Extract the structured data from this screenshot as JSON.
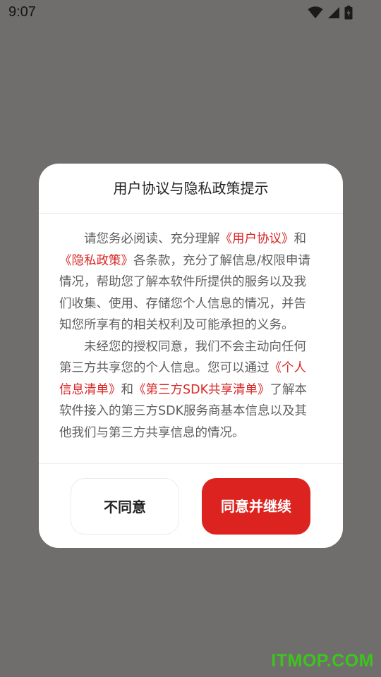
{
  "status_bar": {
    "time": "9:07",
    "icons": [
      "wifi-icon",
      "cellular-signal-icon",
      "battery-charging-icon"
    ]
  },
  "dialog": {
    "title": "用户协议与隐私政策提示",
    "paragraph1": {
      "text1": "请您务必阅读、充分理解",
      "link_user_agreement": "《用户协议》",
      "text2": "和",
      "link_privacy_policy": "《隐私政策》",
      "text3": "各条款，充分了解信息/权限申请情况，帮助您了解本软件所提供的服务以及我们收集、使用、存储您个人信息的情况，并告知您所享有的相关权利及可能承担的义务。"
    },
    "paragraph2": {
      "text1": "未经您的授权同意，我们不会主动向任何第三方共享您的个人信息。您可以通过",
      "link_personal_info_list": "《个人信息清单》",
      "text2": "和",
      "link_third_party_sdk_list": "《第三方SDK共享清单》",
      "text3": "了解本软件接入的第三方SDK服务商基本信息以及其他我们与第三方共享信息的情况。"
    },
    "buttons": {
      "disagree": "不同意",
      "agree": "同意并继续"
    }
  },
  "watermark": "ITMOP.COM",
  "colors": {
    "accent": "#dc231f",
    "link": "#d92626",
    "overlay": "#6f6e6c",
    "watermark": "#3ec41f"
  }
}
